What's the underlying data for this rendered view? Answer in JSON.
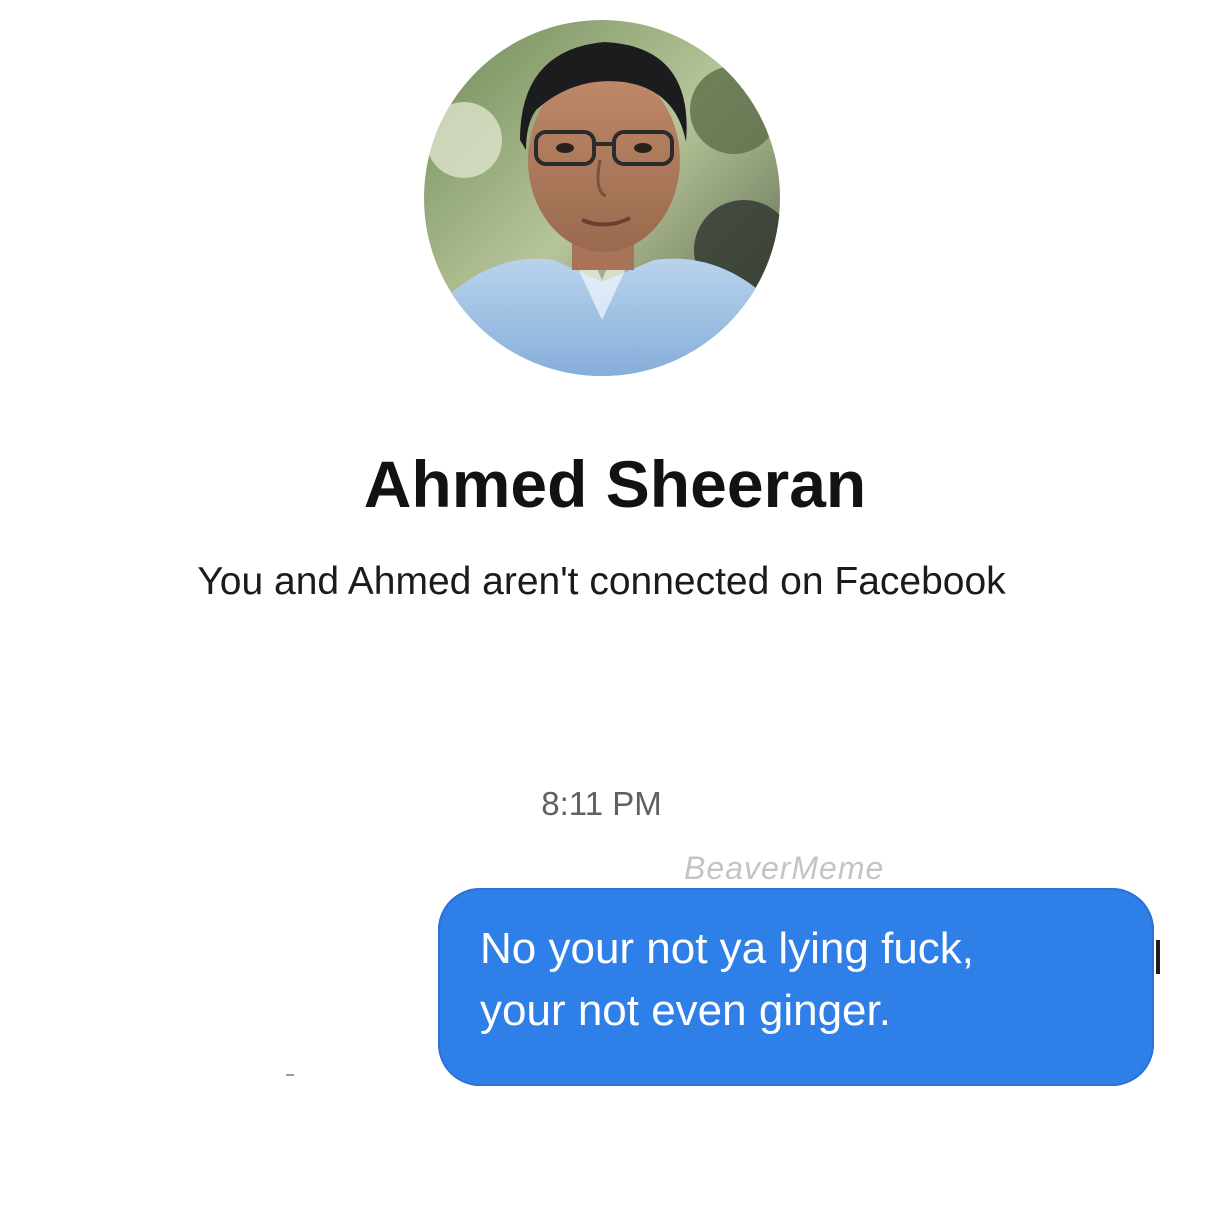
{
  "profile": {
    "name": "Ahmed Sheeran",
    "connection_notice": "You and Ahmed aren't connected on Facebook"
  },
  "conversation": {
    "timestamp": "8:11 PM",
    "watermark": "BeaverMeme",
    "messages": [
      {
        "direction": "outgoing",
        "lines": [
          "No your not ya lying fuck,",
          "your not even ginger."
        ]
      }
    ]
  },
  "colors": {
    "bubble": "#2f7fe8",
    "background": "#ffffff",
    "timestamp": "#5f6165"
  }
}
